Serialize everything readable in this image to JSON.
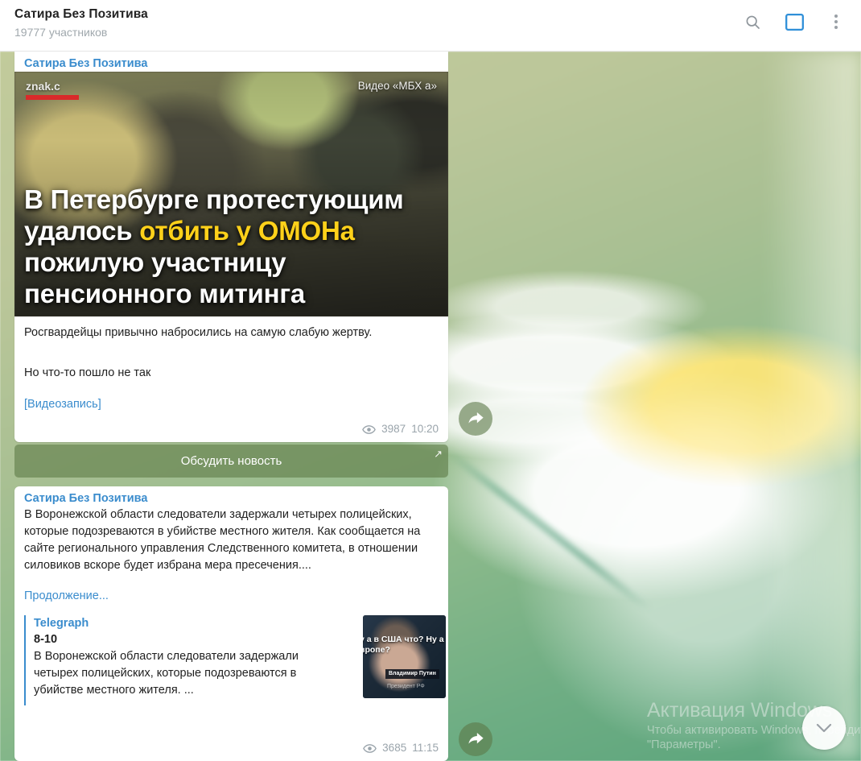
{
  "header": {
    "title": "Сатира Без Позитива",
    "subtitle": "19777 участников",
    "icons": {
      "search": "search-icon",
      "panel": "split-panel-icon",
      "menu": "more-vertical-icon"
    }
  },
  "colors": {
    "link": "#3a8ccd",
    "accent_blue": "#2f8fd8",
    "highlight_yellow": "#ffd11a",
    "wallpaper_green": "#9fbb8d",
    "button_green": "rgba(95,125,72,.62)"
  },
  "messages": [
    {
      "sender": "Сатира Без Позитива",
      "media": {
        "type": "video",
        "watermark": "znak.c",
        "credit": "Видео «МБХ   а»",
        "headline_parts": [
          {
            "text": "В Петербурге протестующим удалось ",
            "highlight": false
          },
          {
            "text": "отбить у ОМОНа",
            "highlight": true
          },
          {
            "text": " пожилую участницу пенсионного митинга",
            "highlight": false
          }
        ]
      },
      "text_lines": [
        "Росгвардейцы привычно набросились на самую слабую жертву.",
        "Но что-то пошло не так"
      ],
      "link_text": "[Видеозапись]",
      "views": "3987",
      "time": "10:20",
      "keyboard_button": "Обсудить новость"
    },
    {
      "sender": "Сатира Без Позитива",
      "body": "В Воронежской области следователи задержали четырех полицейских, которые подозреваются в убийстве местного жителя. Как сообщается на сайте регионального управления Следственного комитета, в отношении силовиков вскоре будет избрана мера пресечения....",
      "continue_link": "Продолжение...",
      "preview": {
        "site": "Telegraph",
        "title": "8-10",
        "description": "В Воронежской области следователи задержали четырех полицейских, которые подозреваются в убийстве местного жителя. ...",
        "thumb_caption": "у а в США что? Ну а\nвропе?",
        "thumb_name": "Владимир\nПутин",
        "thumb_role": "Президент РФ"
      },
      "views": "3685",
      "time": "11:15"
    }
  ],
  "watermark": {
    "line1": "Активация Windows",
    "line2": "Чтобы активировать Windows, перейдите в раздел",
    "line3": "\"Параметры\"."
  },
  "scroll_button": "scroll-to-bottom"
}
